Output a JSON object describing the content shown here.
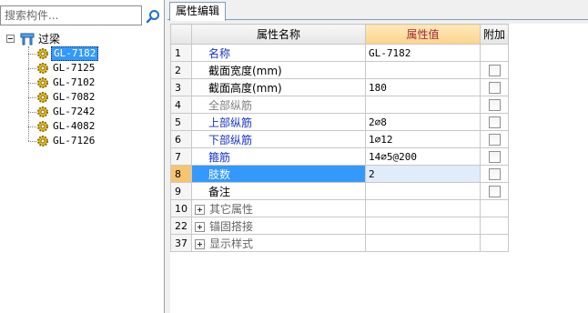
{
  "search": {
    "placeholder": "搜索构件..."
  },
  "tree": {
    "root_label": "过梁",
    "items": [
      {
        "label": "GL-7182",
        "selected": true
      },
      {
        "label": "GL-7125"
      },
      {
        "label": "GL-7102"
      },
      {
        "label": "GL-7082"
      },
      {
        "label": "GL-7242"
      },
      {
        "label": "GL-4082"
      },
      {
        "label": "GL-7126"
      }
    ]
  },
  "tabs": [
    {
      "label": "属性编辑"
    }
  ],
  "grid": {
    "headers": {
      "name": "属性名称",
      "value": "属性值",
      "attach": "附加"
    },
    "rows": [
      {
        "num": "1",
        "name": "名称",
        "value": "GL-7182",
        "style": "blue",
        "checkbox": false
      },
      {
        "num": "2",
        "name": "截面宽度(mm)",
        "value": "",
        "style": "normal",
        "checkbox": true
      },
      {
        "num": "3",
        "name": "截面高度(mm)",
        "value": "180",
        "style": "normal",
        "checkbox": true
      },
      {
        "num": "4",
        "name": "全部纵筋",
        "value": "",
        "style": "gray",
        "checkbox": true
      },
      {
        "num": "5",
        "name": "上部纵筋",
        "value": "2⌀8",
        "style": "blue",
        "checkbox": true
      },
      {
        "num": "6",
        "name": "下部纵筋",
        "value": "1⌀12",
        "style": "blue",
        "checkbox": true
      },
      {
        "num": "7",
        "name": "箍筋",
        "value": "14⌀5@200",
        "style": "blue",
        "checkbox": true
      },
      {
        "num": "8",
        "name": "肢数",
        "value": "2",
        "style": "selected",
        "checkbox": true
      },
      {
        "num": "9",
        "name": "备注",
        "value": "",
        "style": "normal",
        "checkbox": true
      }
    ],
    "groups": [
      {
        "num": "10",
        "label": "其它属性"
      },
      {
        "num": "22",
        "label": "锚固搭接"
      },
      {
        "num": "37",
        "label": "显示样式"
      }
    ]
  },
  "colors": {
    "selection": "#3399ff",
    "link_blue": "#1433c8",
    "header_value_bg": "#fbd48c",
    "header_value_text": "#a0283c"
  }
}
